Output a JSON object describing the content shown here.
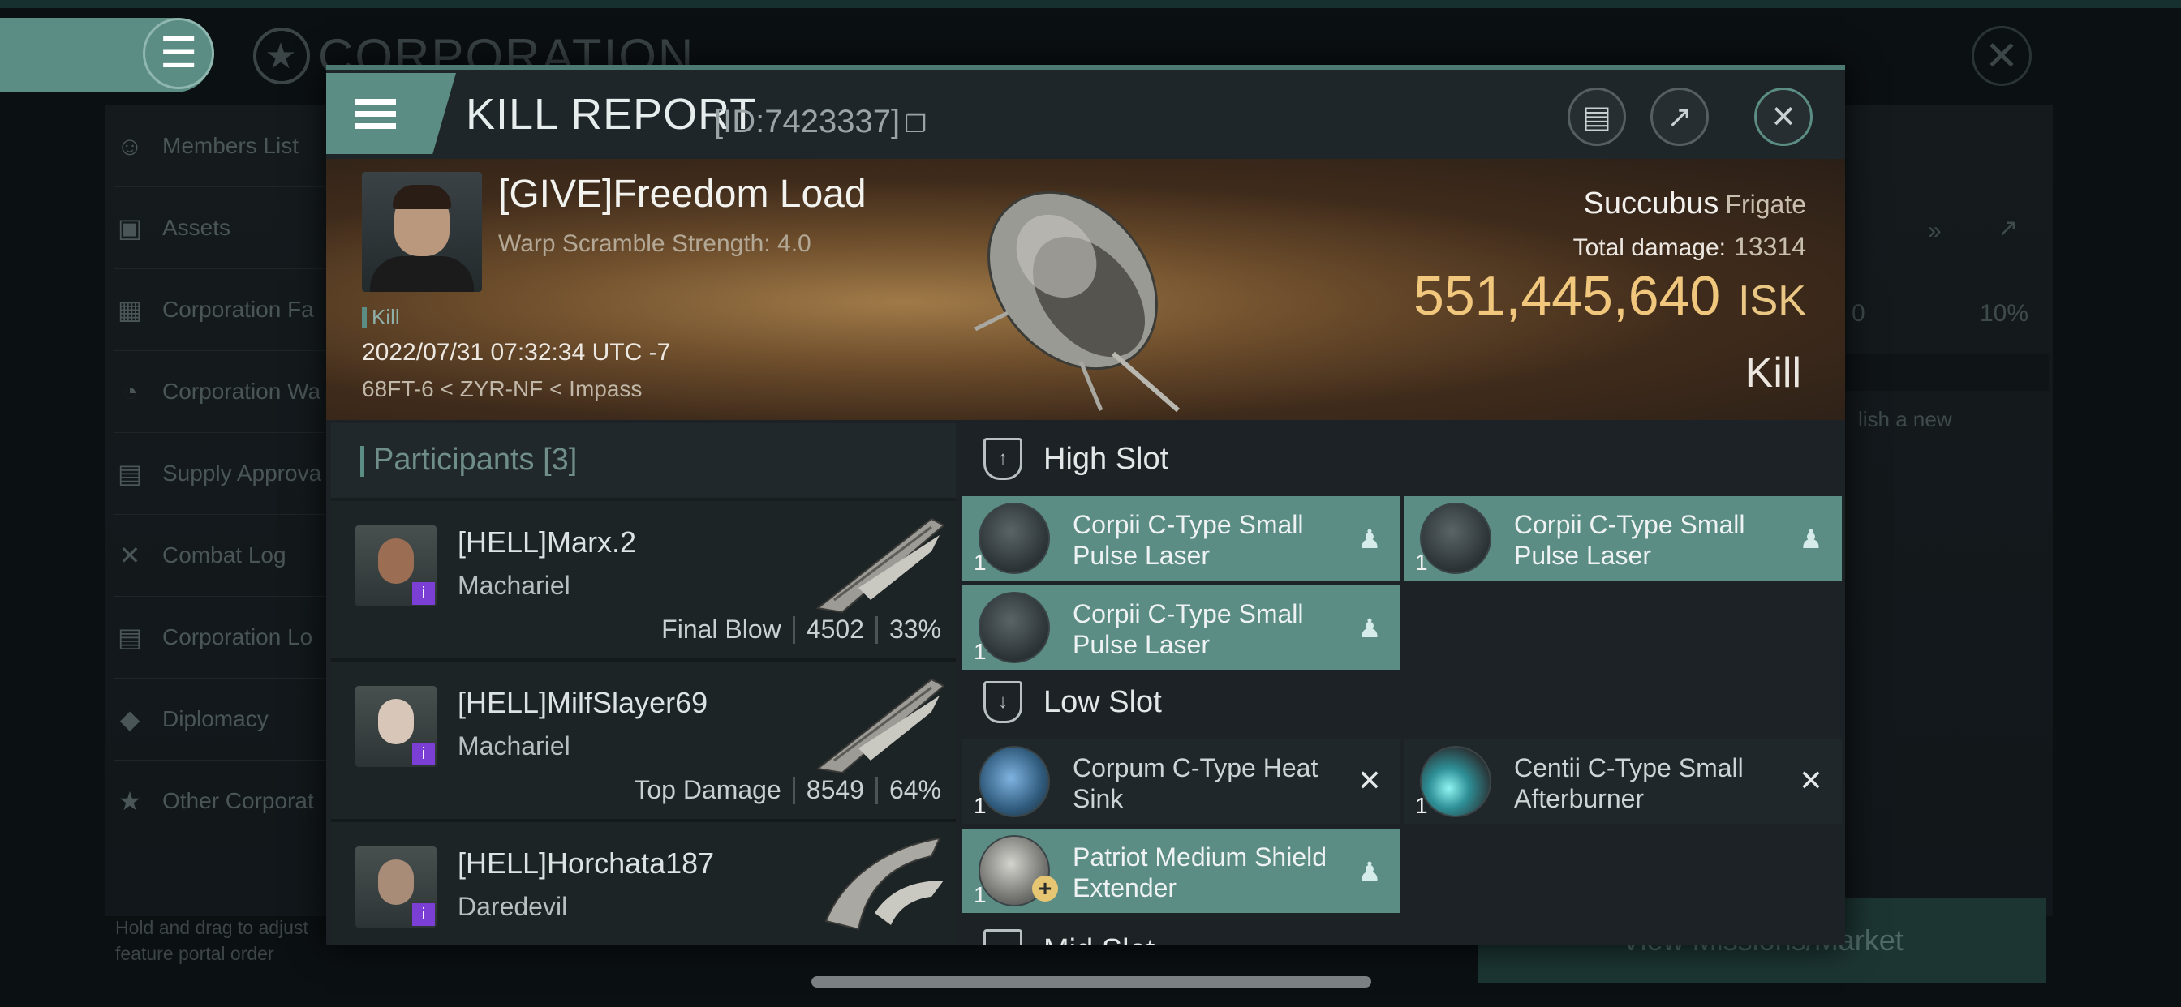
{
  "background": {
    "corp_title": "CORPORATION",
    "side_items": [
      {
        "label": "Members List",
        "icon": "members-icon"
      },
      {
        "label": "Assets",
        "icon": "assets-icon"
      },
      {
        "label": "Corporation Fa",
        "icon": "facility-icon"
      },
      {
        "label": "Corporation Wa",
        "icon": "wallet-icon"
      },
      {
        "label": "Supply Approva",
        "icon": "supply-icon"
      },
      {
        "label": "Combat Log",
        "icon": "combat-icon"
      },
      {
        "label": "Corporation Lo",
        "icon": "log-icon"
      },
      {
        "label": "Diplomacy",
        "icon": "diplomacy-icon"
      },
      {
        "label": "Other Corporat",
        "icon": "star-icon"
      }
    ],
    "hint": "Hold and drag to adjust feature portal order",
    "right_vals": [
      "0",
      "10%"
    ],
    "right_text": "lish a new",
    "bottom_button": "View Missions/Market"
  },
  "dialog": {
    "title": "KILL REPORT",
    "id_text": "[ID:7423337]",
    "victim": {
      "name": "[GIVE]Freedom Load",
      "subtitle": "Warp Scramble Strength: 4.0",
      "tag": "Kill",
      "datetime": "2022/07/31 07:32:34 UTC -7",
      "location": "68FT-6 < ZYR-NF < Impass"
    },
    "ship": {
      "name": "Succubus",
      "class": "Frigate",
      "total_damage_label": "Total damage:",
      "total_damage": "13314",
      "value": "551,445,640",
      "currency": "ISK",
      "result": "Kill"
    },
    "participants": {
      "header": "Participants",
      "count": "[3]",
      "rows": [
        {
          "name": "[HELL]Marx.2",
          "ship": "Machariel",
          "label": "Final Blow",
          "damage": "4502",
          "percent": "33%"
        },
        {
          "name": "[HELL]MilfSlayer69",
          "ship": "Machariel",
          "label": "Top Damage",
          "damage": "8549",
          "percent": "64%"
        },
        {
          "name": "[HELL]Horchata187",
          "ship": "Daredevil",
          "label": "",
          "damage": "",
          "percent": ""
        }
      ]
    },
    "slots": {
      "high": {
        "title": "High Slot",
        "modules": [
          {
            "name": "Corpii C-Type Small Pulse Laser",
            "qty": "1",
            "state": "fitted"
          },
          {
            "name": "Corpii C-Type Small Pulse Laser",
            "qty": "1",
            "state": "fitted"
          },
          {
            "name": "Corpii C-Type Small Pulse Laser",
            "qty": "1",
            "state": "fitted"
          }
        ]
      },
      "low": {
        "title": "Low Slot",
        "modules": [
          {
            "name": "Corpum C-Type Heat Sink",
            "qty": "1",
            "state": "destroyed"
          },
          {
            "name": "Centii C-Type Small Afterburner",
            "qty": "1",
            "state": "destroyed"
          },
          {
            "name": "Patriot Medium Shield Extender",
            "qty": "1",
            "state": "fitted"
          }
        ]
      },
      "mid": {
        "title": "Mid Slot"
      }
    }
  }
}
